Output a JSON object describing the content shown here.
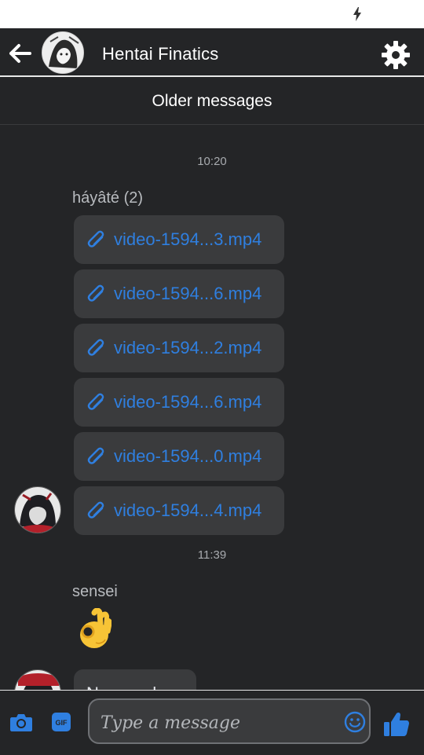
{
  "header": {
    "title": "Hentai Finatics"
  },
  "older_messages_label": "Older messages",
  "groups": [
    {
      "time": "10:20",
      "sender": "háyâté (2)",
      "attachments": [
        "video-1594...3.mp4",
        "video-1594...6.mp4",
        "video-1594...2.mp4",
        "video-1594...6.mp4",
        "video-1594...0.mp4",
        "video-1594...4.mp4"
      ]
    },
    {
      "time": "11:39",
      "sender": "sensei",
      "reaction_emoji": "ok-hand"
    }
  ],
  "partial_message": "Nee ne da",
  "composer": {
    "placeholder": "Type a message"
  },
  "colors": {
    "accent": "#2f7fe0",
    "background": "#242527",
    "bubble": "#3a3b3d"
  }
}
